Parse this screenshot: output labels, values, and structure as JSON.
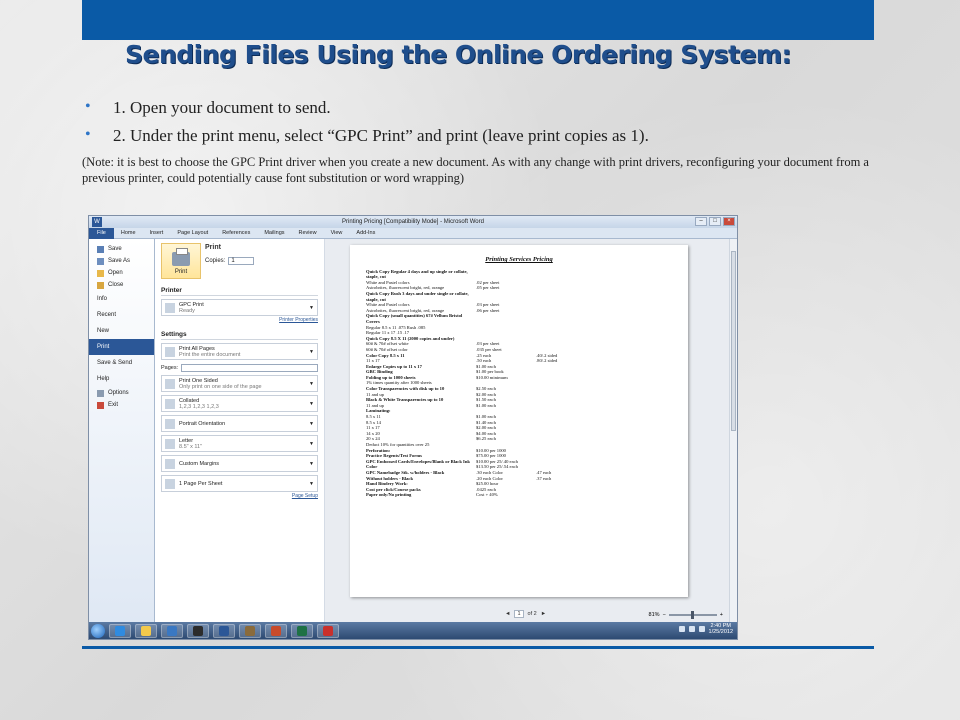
{
  "slide": {
    "title": "Sending Files Using the Online Ordering System:",
    "bullets": [
      "1. Open your document to send.",
      "2. Under the print menu, select “GPC Print” and print (leave print copies as 1)."
    ],
    "note": "(Note: it is best to choose the GPC Print driver when you create a new document. As with any change with print drivers, reconfiguring your document from a previous printer, could potentially cause font substitution or word wrapping)",
    "colors": {
      "accent": "#0a5aa6",
      "title": "#1f4e8c"
    }
  },
  "word": {
    "window_title": "Printing Pricing [Compatibility Mode] - Microsoft Word",
    "tabs": [
      "File",
      "Home",
      "Insert",
      "Page Layout",
      "References",
      "Mailings",
      "Review",
      "View",
      "Add-Ins"
    ],
    "backstage_nav_top": [
      {
        "label": "Save",
        "icon": "save-icon"
      },
      {
        "label": "Save As",
        "icon": "save-as-icon"
      },
      {
        "label": "Open",
        "icon": "open-folder-icon"
      },
      {
        "label": "Close",
        "icon": "close-document-icon"
      }
    ],
    "backstage_nav_sections": [
      "Info",
      "Recent",
      "New",
      "Print",
      "Save & Send",
      "Help"
    ],
    "backstage_nav_bottom": [
      {
        "label": "Options",
        "icon": "options-icon"
      },
      {
        "label": "Exit",
        "icon": "exit-icon"
      }
    ],
    "print": {
      "heading": "Print",
      "button_label": "Print",
      "copies_label": "Copies:",
      "copies_value": "1",
      "printer_section": "Printer",
      "printer_name": "GPC Print",
      "printer_status": "Ready",
      "printer_properties": "Printer Properties",
      "settings_section": "Settings",
      "settings": [
        {
          "main": "Print All Pages",
          "sub": "Print the entire document"
        },
        {
          "main": "Print One Sided",
          "sub": "Only print on one side of the page"
        },
        {
          "main": "Collated",
          "sub": "1,2,3   1,2,3   1,2,3"
        },
        {
          "main": "Portrait Orientation",
          "sub": ""
        },
        {
          "main": "Letter",
          "sub": "8.5\" x 11\""
        },
        {
          "main": "Custom Margins",
          "sub": ""
        },
        {
          "main": "1 Page Per Sheet",
          "sub": ""
        }
      ],
      "pages_label": "Pages:",
      "page_setup": "Page Setup"
    },
    "preview": {
      "doc_title": "Printing Services Pricing",
      "lines": [
        [
          "Quick Copy Regular 4 days and up single or collate, staple, cut",
          "",
          "",
          true
        ],
        [
          "",
          "",
          "",
          false
        ],
        [
          "White and Pastel colors",
          ".02 per sheet",
          "",
          false
        ],
        [
          "Astrobrites, fluorescent bright, red, orange",
          ".05 per sheet",
          "",
          false
        ],
        [
          "",
          "",
          "",
          false
        ],
        [
          "Quick Copy Rush 3 days and under single or collate, staple, cut",
          "",
          "",
          true
        ],
        [
          "",
          "",
          "",
          false
        ],
        [
          "White and Pastel colors",
          ".03 per sheet",
          "",
          false
        ],
        [
          "Astrobrites, fluorescent bright, red, orange",
          ".06 per sheet",
          "",
          false
        ],
        [
          "",
          "",
          "",
          false
        ],
        [
          "Quick Copy (small quantities) 67# Vellum Bristol Covers",
          "",
          "",
          true
        ],
        [
          "",
          "",
          "",
          false
        ],
        [
          "Regular    8.5 x 11    .075    Rush    .085",
          "",
          "",
          false
        ],
        [
          "Regular    11 x 17    .15    .17",
          "",
          "",
          false
        ],
        [
          "",
          "",
          "",
          false
        ],
        [
          "Quick Copy 8.5 X 11 (2000 copies and under)",
          "",
          "",
          true
        ],
        [
          "",
          "",
          "",
          false
        ],
        [
          "60# & 70# offset white",
          ".03 per sheet",
          "",
          false
        ],
        [
          "60# & 70# offset color",
          ".035 per sheet",
          "",
          false
        ],
        [
          "Color Copy    8.5 x 11",
          ".25 each",
          ".40/.2 sided",
          true
        ],
        [
          "11 x 17",
          ".50 each",
          ".80/.2 sided",
          false
        ],
        [
          "Enlarge Copies up to 11 x 17",
          "$1.00 each",
          "",
          true
        ],
        [
          "GBC Binding",
          "$1.00 per book",
          "",
          true
        ],
        [
          "Folding up to 1000 sheets",
          "$10.00 minimum",
          "",
          true
        ],
        [
          "1% times quantity after 1000 sheets",
          "",
          "",
          false
        ],
        [
          "Color Transparencies with disk up to 10",
          "$2.50 each",
          "",
          true
        ],
        [
          "11 and up",
          "$2.00 each",
          "",
          false
        ],
        [
          "",
          "",
          "",
          false
        ],
        [
          "Black & White Transparencies up to 10",
          "$1.50 each",
          "",
          true
        ],
        [
          "11 and up",
          "$1.00 each",
          "",
          false
        ],
        [
          "",
          "",
          "",
          false
        ],
        [
          "Laminating:",
          "",
          "",
          true
        ],
        [
          "8.5 x 11",
          "$1.00 each",
          "",
          false
        ],
        [
          "8.5 x 14",
          "$1.40 each",
          "",
          false
        ],
        [
          "11 x 17",
          "$2.00 each",
          "",
          false
        ],
        [
          "14 x 20",
          "$4.00 each",
          "",
          false
        ],
        [
          "20 x 24",
          "$6.25 each",
          "",
          false
        ],
        [
          "Deduct 10% for quantities over 25",
          "",
          "",
          false
        ],
        [
          "",
          "",
          "",
          false
        ],
        [
          "Perforation:",
          "$10.00 per 1000",
          "",
          true
        ],
        [
          "",
          "",
          "",
          false
        ],
        [
          "Practice Regents/Test Forms",
          "$75.00 per 1000",
          "",
          true
        ],
        [
          "",
          "",
          "",
          false
        ],
        [
          "GPC Embossed Cards/Envelopes/Blank or Black Ink",
          "$10.00 per 25/.40 each",
          "",
          true
        ],
        [
          "",
          "",
          "",
          false
        ],
        [
          "Color",
          "$13.50 per 25/.54 each",
          "",
          true
        ],
        [
          "",
          "",
          "",
          false
        ],
        [
          "GPC Namebadge Stk. w/holders - Black",
          ".30 each    Color",
          ".47 each",
          true
        ],
        [
          "Without holders - Black",
          ".20 each    Color",
          ".37 each",
          true
        ],
        [
          "",
          "",
          "",
          false
        ],
        [
          "Hand Bindery Work:",
          "$25.00 hour",
          "",
          true
        ],
        [
          "",
          "",
          "",
          false
        ],
        [
          "Cost per click/Course packs",
          ".0425 each",
          "",
          true
        ],
        [
          "Paper only/No printing",
          "Cost + 40%",
          "",
          true
        ]
      ],
      "page_current": "1",
      "page_total": "of 2",
      "zoom": "81%"
    },
    "tray": {
      "time": "2:40 PM",
      "date": "1/25/2012"
    },
    "taskbar_apps": [
      {
        "name": "ie-icon",
        "color": "#2f8be0"
      },
      {
        "name": "explorer-icon",
        "color": "#f2c94c"
      },
      {
        "name": "outlook-icon",
        "color": "#3a78c2"
      },
      {
        "name": "media-icon",
        "color": "#2c2c2c"
      },
      {
        "name": "word-icon",
        "color": "#2b5797"
      },
      {
        "name": "users-icon",
        "color": "#8a6b3c"
      },
      {
        "name": "people-icon",
        "color": "#c84b2b"
      },
      {
        "name": "excel-icon",
        "color": "#1e7145"
      },
      {
        "name": "acrobat-icon",
        "color": "#c9302c"
      }
    ]
  }
}
